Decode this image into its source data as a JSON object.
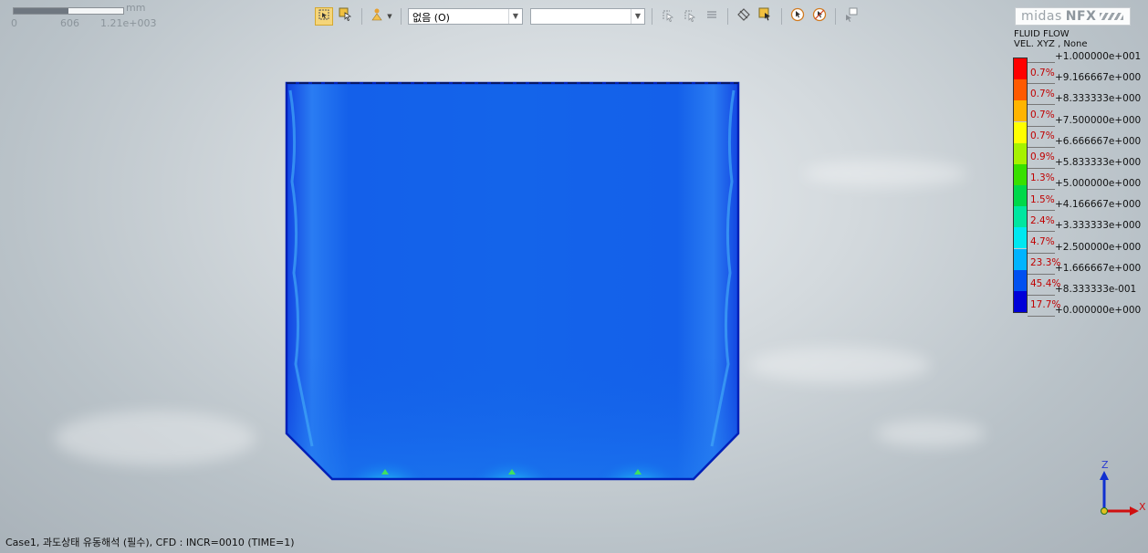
{
  "scale_bar": {
    "unit": "mm",
    "labels": [
      "0",
      "606",
      "1.21e+003"
    ]
  },
  "toolbar": {
    "combo1_value": "없음 (O)",
    "combo2_value": ""
  },
  "logo": {
    "text": "midas",
    "brand": "NFX"
  },
  "legend": {
    "title": "FLUID FLOW",
    "subtitle": "VEL. XYZ , None",
    "values": [
      "+1.000000e+001",
      "+9.166667e+000",
      "+8.333333e+000",
      "+7.500000e+000",
      "+6.666667e+000",
      "+5.833333e+000",
      "+5.000000e+000",
      "+4.166667e+000",
      "+3.333333e+000",
      "+2.500000e+000",
      "+1.666667e+000",
      "+8.333333e-001",
      "+0.000000e+000"
    ],
    "percents": [
      "0.7%",
      "0.7%",
      "0.7%",
      "0.7%",
      "0.9%",
      "1.3%",
      "1.5%",
      "2.4%",
      "4.7%",
      "23.3%",
      "45.4%",
      "17.7%"
    ],
    "colors": [
      "#ff0000",
      "#ff5a00",
      "#ffb400",
      "#ffff00",
      "#a6f200",
      "#38e000",
      "#00d84a",
      "#00e6a0",
      "#00e8f0",
      "#00b4ff",
      "#0050f0",
      "#0000d8"
    ]
  },
  "status": {
    "text": "Case1,  과도상태 유동해석 (필수),  CFD : INCR=0010 (TIME=1)"
  },
  "axes": {
    "z": "Z",
    "x": "X"
  }
}
